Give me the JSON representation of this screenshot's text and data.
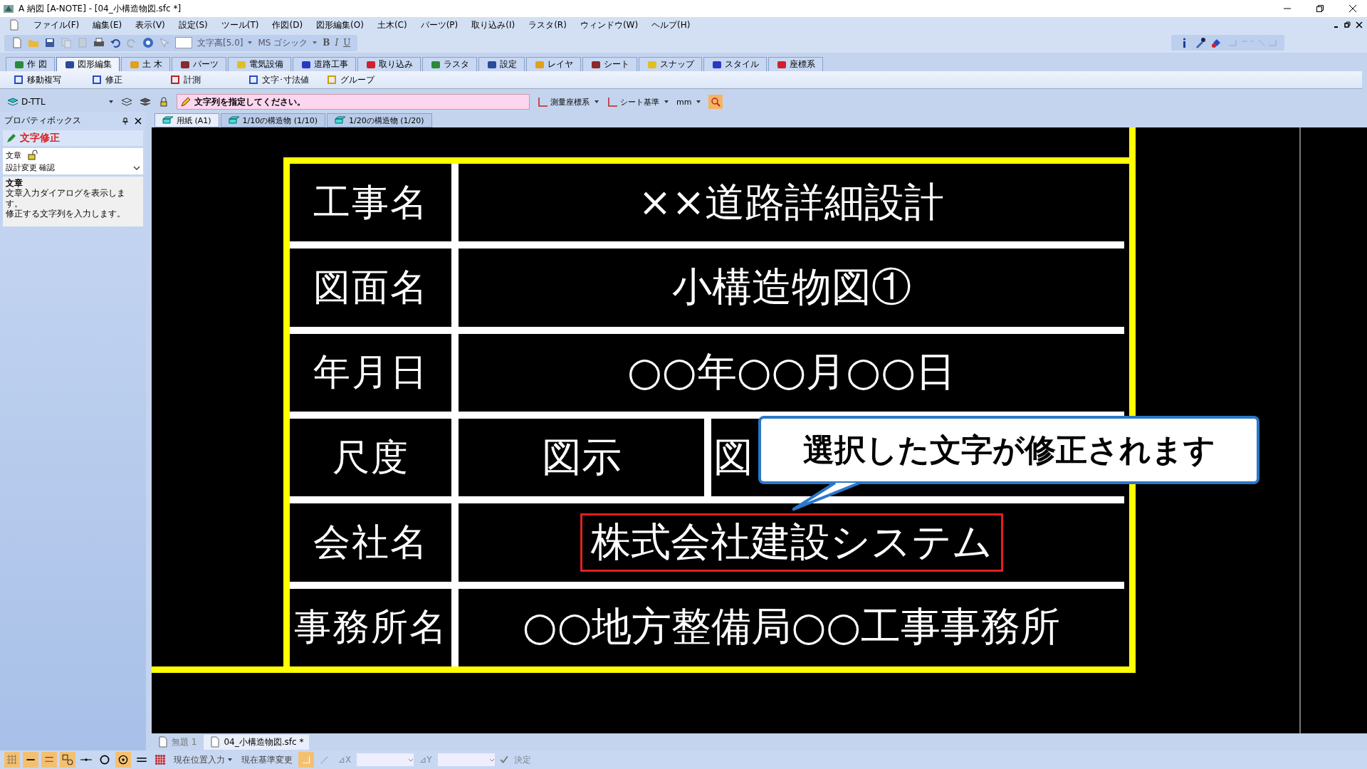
{
  "window": {
    "title": "A 納図 [A-NOTE] - [04_小構造物図.sfc *]"
  },
  "menu": [
    "ファイル(F)",
    "編集(E)",
    "表示(V)",
    "設定(S)",
    "ツール(T)",
    "作図(D)",
    "図形編集(O)",
    "土木(C)",
    "パーツ(P)",
    "取り込み(I)",
    "ラスタ(R)",
    "ウィンドウ(W)",
    "ヘルプ(H)"
  ],
  "toolbar": {
    "text_height": "文字高[5.0]",
    "font": "MS ゴシック",
    "bold": "B",
    "italic": "I",
    "underline": "U"
  },
  "ribbon_tabs": [
    {
      "label": "作 図",
      "selected": false
    },
    {
      "label": "図形編集",
      "selected": true
    },
    {
      "label": "土 木",
      "selected": false
    },
    {
      "label": "パーツ",
      "selected": false
    },
    {
      "label": "電気設備",
      "selected": false
    },
    {
      "label": "道路工事",
      "selected": false
    },
    {
      "label": "取り込み",
      "selected": false
    },
    {
      "label": "ラスタ",
      "selected": false
    },
    {
      "label": "設定",
      "selected": false
    },
    {
      "label": "レイヤ",
      "selected": false
    },
    {
      "label": "シート",
      "selected": false
    },
    {
      "label": "スナップ",
      "selected": false
    },
    {
      "label": "スタイル",
      "selected": false
    },
    {
      "label": "座標系",
      "selected": false
    }
  ],
  "tools": [
    "移動複写",
    "修正",
    "計測",
    "文字･寸法値",
    "グループ"
  ],
  "layer": "D-TTL",
  "prompt": "文字列を指定してください。",
  "coordinates": [
    "測量座標系",
    "シート基準",
    "mm"
  ],
  "property_box": {
    "title": "プロパティボックス",
    "heading": "文字修正",
    "field_label": "文章",
    "field_value": "設計変更  確認",
    "description_title": "文章",
    "description": [
      "文章入力ダイアログを表示します。",
      "修正する文字列を入力します。"
    ]
  },
  "sheet_tabs": [
    {
      "label": "用紙 (A1)",
      "selected": true
    },
    {
      "label": "1/10の構造物 (1/10)",
      "selected": false
    },
    {
      "label": "1/20の構造物 (1/20)",
      "selected": false
    }
  ],
  "drawing": {
    "rows": [
      {
        "label": "工事名",
        "values": [
          "××道路詳細設計"
        ],
        "selected": false
      },
      {
        "label": "図面名",
        "values": [
          "小構造物図①"
        ],
        "selected": false
      },
      {
        "label": "年月日",
        "values": [
          "○○年○○月○○日"
        ],
        "selected": false
      },
      {
        "label": "尺度",
        "values": [
          "図示",
          "図"
        ],
        "selected": false
      },
      {
        "label": "会社名",
        "values": [
          "株式会社建設システム"
        ],
        "selected": true
      },
      {
        "label": "事務所名",
        "values": [
          "○○地方整備局○○工事事務所"
        ],
        "selected": false
      }
    ],
    "callout": "選択した文字が修正されます"
  },
  "file_tabs": [
    {
      "label": "無題 1",
      "selected": false
    },
    {
      "label": "04_小構造物図.sfc *",
      "selected": true
    }
  ],
  "status_bar": {
    "position_input": "現在位置入力",
    "base_change": "現在基準変更",
    "dx": "⊿X",
    "dy": "⊿Y",
    "confirm": "決定"
  }
}
